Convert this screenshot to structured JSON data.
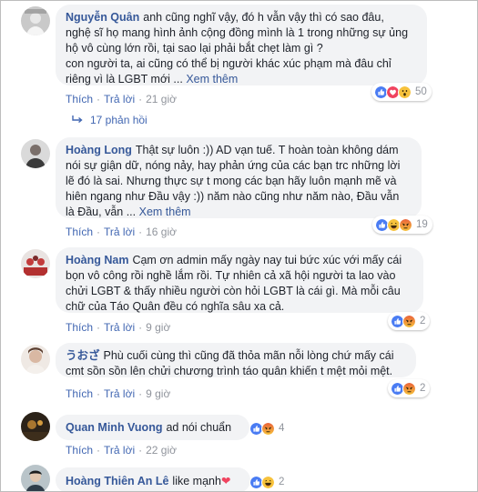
{
  "comments": [
    {
      "name": "Nguyễn Quân",
      "lines": [
        "anh cũng nghĩ vậy, đó h vẫn vậy thì có sao đâu,",
        "nghệ sĩ họ mang hình ảnh cộng đồng mình là 1 trong những sự ủng",
        "hộ vô cùng lớn rồi, tại sao lại phải bắt chẹt làm gì ?",
        "con người ta, ai cũng có thể bị người khác xúc phạm mà đâu chỉ",
        "riêng vì là LGBT mới ..."
      ],
      "see_more": "Xem thêm",
      "like": "Thích",
      "reply": "Trả lời",
      "time": "21 giờ",
      "reactions": [
        "like",
        "love",
        "wow"
      ],
      "reaction_count": "50"
    },
    {
      "name": "Hoàng Long",
      "lines": [
        "Thật sự luôn :)) AD vạn tuế. T hoàn toàn không dám",
        "nói sự giận dữ, nóng nảy, hay phản ứng của các bạn trc những lời",
        "lẽ đó là sai. Nhưng thực sự t mong các bạn hãy luôn mạnh mẽ và",
        "hiên ngang như Đầu vậy :)) năm nào cũng như năm nào, Đầu vẫn",
        "là Đầu, vẫn ..."
      ],
      "see_more": "Xem thêm",
      "like": "Thích",
      "reply": "Trả lời",
      "time": "16 giờ",
      "reactions": [
        "like",
        "haha",
        "angry"
      ],
      "reaction_count": "19"
    },
    {
      "name": "Hoàng Nam",
      "lines": [
        "Cạm ơn admin mấy ngày nay tui bức xúc với mấy cái",
        "bọn vô công rồi nghề lắm rồi. Tự nhiên cả xã hội người ta lao vào",
        "chửi LGBT & thấy nhiều người còn hỏi LGBT là cái gì. Mà mỗi câu",
        "chữ của Táo Quân đều có nghĩa sâu xa cả."
      ],
      "like": "Thích",
      "reply": "Trả lời",
      "time": "9 giờ",
      "reactions": [
        "like",
        "angry"
      ],
      "reaction_count": "2"
    },
    {
      "name": "うおざ",
      "lines": [
        "Phù cuối cùng thì cũng đã thỏa mãn nỗi lòng chứ mấy cái",
        "cmt sồn sồn lên chửi chương trình táo quân khiến t mệt mỏi mệt."
      ],
      "like": "Thích",
      "reply": "Trả lời",
      "time": "9 giờ",
      "reactions": [
        "like",
        "angry"
      ],
      "reaction_count": "2"
    },
    {
      "name": "Quan Minh Vuong",
      "text": "ad nói chuẩn",
      "like": "Thích",
      "reply": "Trả lời",
      "time": "22 giờ",
      "reactions": [
        "like",
        "angry"
      ],
      "reaction_count": "4"
    },
    {
      "name": "Hoàng Thiên An Lê",
      "text": "like mạnh",
      "emoji": "❤",
      "reactions": [
        "like",
        "haha"
      ],
      "reaction_count": "2"
    }
  ],
  "replies_label": "17 phản hồi",
  "colors": {
    "link": "#365899",
    "action": "#4267b2",
    "muted": "#90949c",
    "bubble": "#f2f3f5",
    "like": "#4a7cf3",
    "love": "#f0435f",
    "wow": "#f7c23c",
    "haha": "#f7c23c",
    "angry": "#e9623a"
  },
  "icons": {
    "like": "thumbs-up-icon",
    "love": "heart-icon",
    "wow": "wow-face-icon",
    "haha": "haha-face-icon",
    "angry": "angry-face-icon",
    "reply": "reply-arrow-icon"
  }
}
